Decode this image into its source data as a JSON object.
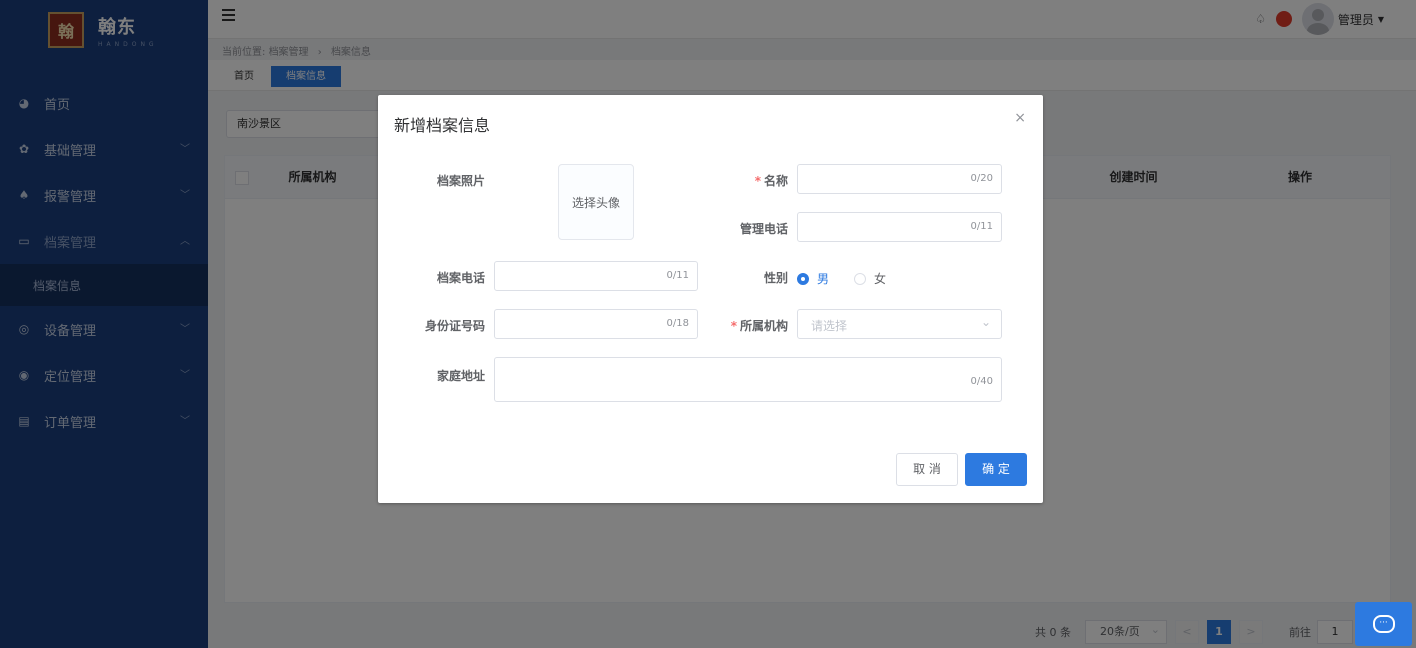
{
  "app": {
    "logo_glyph": "翰东",
    "logo_text": "翰东",
    "logo_sub": "HANDONG"
  },
  "sidebar": {
    "items": [
      {
        "label": "首页",
        "icon": "dashboard-icon"
      },
      {
        "label": "基础管理",
        "icon": "gear-icon"
      },
      {
        "label": "报警管理",
        "icon": "bell-icon"
      },
      {
        "label": "档案管理",
        "icon": "folder-icon"
      },
      {
        "label": "设备管理",
        "icon": "device-icon"
      },
      {
        "label": "定位管理",
        "icon": "location-icon"
      },
      {
        "label": "订单管理",
        "icon": "order-icon"
      }
    ],
    "subitem": "档案信息"
  },
  "topbar": {
    "user": "管理员"
  },
  "breadcrumb": {
    "prefix": "当前位置:",
    "level1": "档案管理",
    "level2": "档案信息"
  },
  "tags": {
    "home": "首页",
    "active": "档案信息"
  },
  "filter": {
    "value": "南沙景区"
  },
  "table": {
    "columns": [
      "所属机构",
      "创建时间",
      "操作"
    ]
  },
  "pagination": {
    "total": "共 0 条",
    "page_size": "20条/页",
    "prev": "<",
    "current": "1",
    "next": ">",
    "goto_label": "前往",
    "goto_value": "1"
  },
  "dialog": {
    "title": "新增档案信息",
    "close": "×",
    "photo_label": "档案照片",
    "upload_text": "选择头像",
    "name_label": "名称",
    "name_count": "0/20",
    "manager_phone_label": "管理电话",
    "manager_phone_count": "0/11",
    "archive_phone_label": "档案电话",
    "archive_phone_count": "0/11",
    "gender_label": "性别",
    "gender_male": "男",
    "gender_female": "女",
    "id_label": "身份证号码",
    "id_count": "0/18",
    "org_label": "所属机构",
    "org_placeholder": "请选择",
    "address_label": "家庭地址",
    "address_count": "0/40",
    "required_mark": "*",
    "cancel": "取 消",
    "confirm": "确 定"
  },
  "colors": {
    "sidebar_bg": "#1b3f7f",
    "primary": "#2d7ae0",
    "required": "#f56c6c"
  }
}
